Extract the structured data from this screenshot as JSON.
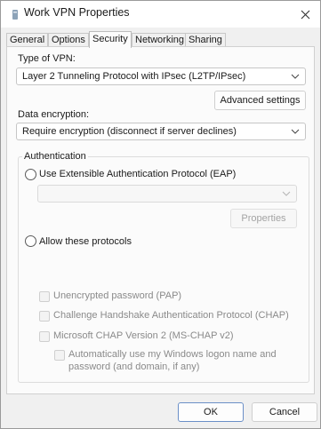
{
  "window": {
    "title": "Work VPN Properties",
    "icon": "vpn-icon",
    "close_icon": "close-icon"
  },
  "tabs": [
    {
      "label": "General",
      "active": false
    },
    {
      "label": "Options",
      "active": false
    },
    {
      "label": "Security",
      "active": true
    },
    {
      "label": "Networking",
      "active": false
    },
    {
      "label": "Sharing",
      "active": false
    }
  ],
  "security": {
    "vpn_type_label": "Type of VPN:",
    "vpn_type_value": "Layer 2 Tunneling Protocol with IPsec (L2TP/IPsec)",
    "advanced_settings_label": "Advanced settings",
    "encryption_label": "Data encryption:",
    "encryption_value": "Require encryption (disconnect if server declines)"
  },
  "authentication": {
    "legend": "Authentication",
    "eap_label": "Use Extensible Authentication Protocol (EAP)",
    "eap_value": "",
    "properties_label": "Properties",
    "allow_protocols_label": "Allow these protocols",
    "protocols": [
      {
        "label": "Unencrypted password (PAP)",
        "checked": false,
        "enabled": false
      },
      {
        "label": "Challenge Handshake Authentication Protocol (CHAP)",
        "checked": false,
        "enabled": false
      },
      {
        "label": "Microsoft CHAP Version 2 (MS-CHAP v2)",
        "checked": false,
        "enabled": false
      }
    ],
    "auto_logon_line1": "Automatically use my Windows logon name and",
    "auto_logon_line2": "password (and domain, if any)"
  },
  "footer": {
    "ok_label": "OK",
    "cancel_label": "Cancel"
  },
  "colors": {
    "window_bg": "#f0f0f0",
    "page_bg": "#fbfbfb",
    "accent_border": "#6a8fc7",
    "disabled_text": "#8a8a8a"
  }
}
